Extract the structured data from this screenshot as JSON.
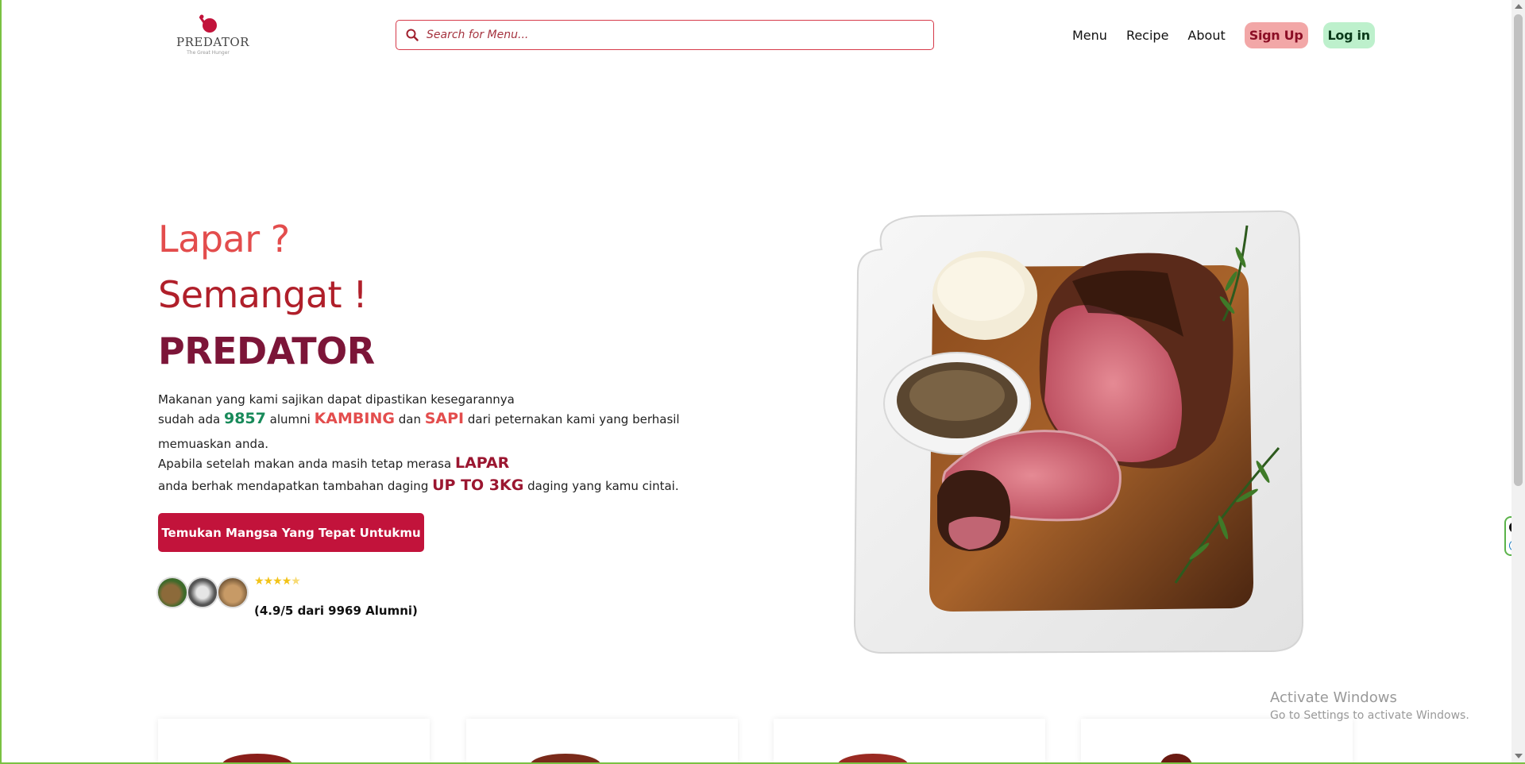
{
  "brand": {
    "logo_text": "PREDATOR",
    "logo_tagline": "The Great Hunger"
  },
  "search": {
    "placeholder": "Search for Menu..."
  },
  "nav": {
    "menu": "Menu",
    "recipe": "Recipe",
    "about": "About",
    "signup": "Sign Up",
    "login": "Log in"
  },
  "hero": {
    "line1": "Lapar ?",
    "line2": "Semangat !",
    "line3": "PREDATOR",
    "desc": {
      "l1": "Makanan yang kami sajikan dapat dipastikan kesegarannya",
      "l2_a": "sudah ada ",
      "l2_num": "9857",
      "l2_b": " alumni ",
      "l2_kambing": "KAMBING",
      "l2_c": " dan ",
      "l2_sapi": "SAPI",
      "l2_d": " dari peternakan kami yang berhasil",
      "l3": "memuaskan anda.",
      "l4_a": "Apabila setelah makan anda masih tetap merasa ",
      "l4_lapar": "LAPAR",
      "l5_a": "anda berhak mendapatkan tambahan daging ",
      "l5_up": "UP TO 3KG",
      "l5_b": " daging yang kamu cintai."
    },
    "cta": "Temukan Mangsa Yang Tepat Untukmu",
    "rating_stars": 4.5,
    "rating_text": "(4.9/5 dari 9969 Alumni)"
  },
  "os": {
    "activate_title": "Activate Windows",
    "activate_sub": "Go to Settings to activate Windows."
  },
  "colors": {
    "accent": "#c2133b",
    "lapar": "#e34d4d",
    "semangat": "#b01f2a",
    "predator": "#7c1538",
    "highlight_green": "#188a5a",
    "signup_bg": "#f2a7a7",
    "login_bg": "#bdf0cc"
  }
}
